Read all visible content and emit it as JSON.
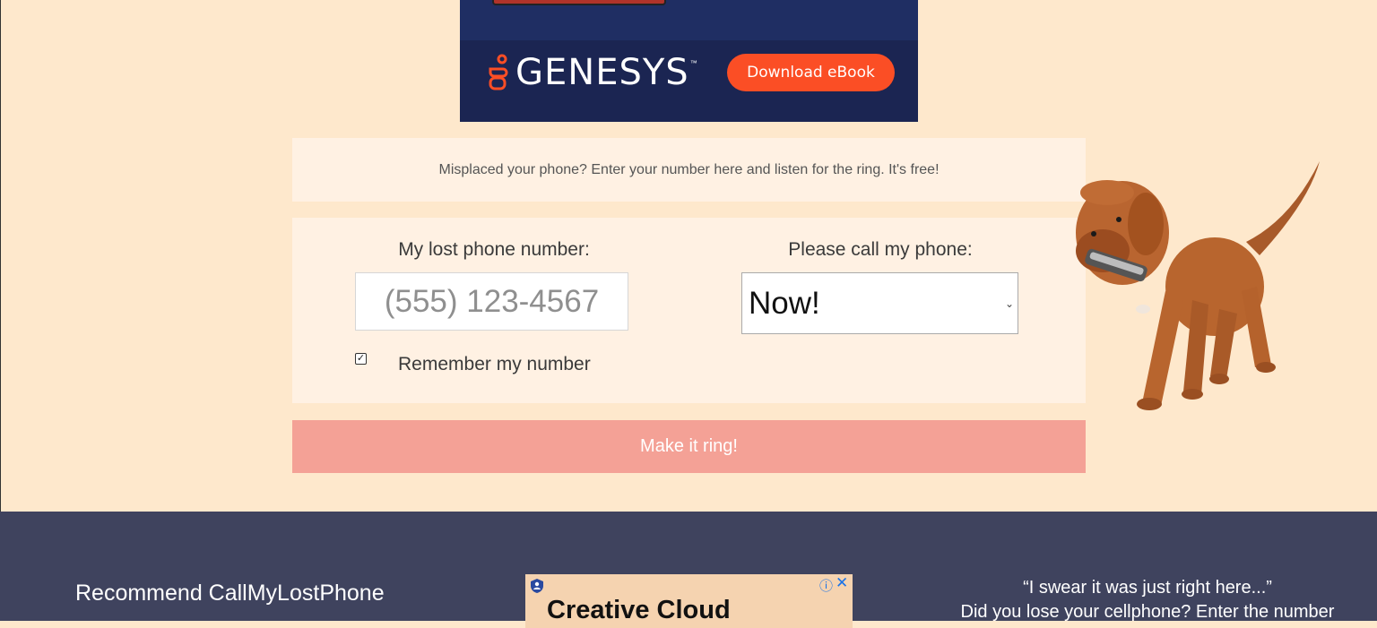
{
  "ad_banner": {
    "brand": "GENESYS",
    "trademark": "™",
    "button_label": "Download eBook",
    "colors": {
      "background": "#1b2552",
      "button": "#fb4e25",
      "logo_mark": "#fb4e25"
    }
  },
  "intro": {
    "text": "Misplaced your phone? Enter your number here and listen for the ring. It's free!"
  },
  "form": {
    "lost_phone_label": "My lost phone number:",
    "phone_placeholder": "(555) 123-4567",
    "phone_value": "",
    "call_label": "Please call my phone:",
    "call_selected": "Now!",
    "remember_label": "Remember my number",
    "remember_checked": true,
    "submit_label": "Make it ring!"
  },
  "footer": {
    "recommend_title": "Recommend CallMyLostPhone",
    "ad_title": "Creative Cloud",
    "quote_line1": "“I swear it was just right here...”",
    "quote_line2": "Did you lose your cellphone? Enter the number"
  },
  "colors": {
    "page_bg": "#fee8cc",
    "panel_bg": "#fff1e3",
    "button_bg": "#f4a196",
    "footer_bg": "#3f435e"
  }
}
